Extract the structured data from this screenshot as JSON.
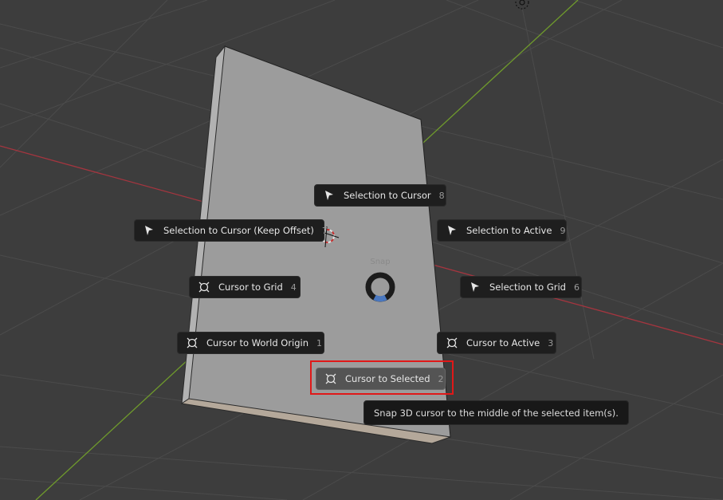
{
  "pie_menu": {
    "title": "Snap",
    "items": [
      {
        "label": "Selection to Cursor",
        "shortcut": "8",
        "icon": "cursor-arrow-icon"
      },
      {
        "label": "Selection to Cursor (Keep Offset)",
        "shortcut": "7",
        "icon": "cursor-arrow-icon"
      },
      {
        "label": "Selection to Active",
        "shortcut": "9",
        "icon": "cursor-arrow-icon"
      },
      {
        "label": "Cursor to Grid",
        "shortcut": "4",
        "icon": "3d-cursor-icon"
      },
      {
        "label": "Selection to Grid",
        "shortcut": "6",
        "icon": "cursor-arrow-icon"
      },
      {
        "label": "Cursor to World Origin",
        "shortcut": "1",
        "icon": "3d-cursor-icon"
      },
      {
        "label": "Cursor to Active",
        "shortcut": "3",
        "icon": "3d-cursor-icon"
      },
      {
        "label": "Cursor to Selected",
        "shortcut": "2",
        "icon": "3d-cursor-icon"
      }
    ],
    "active_item": "Cursor to Selected"
  },
  "tooltip": {
    "text": "Snap 3D cursor to the middle of the selected item(s)."
  },
  "colors": {
    "background": "#3d3d3d",
    "grid": "#4a4a4a",
    "x_axis": "#a5353f",
    "y_axis": "#6f9a2c",
    "object_face": "#9b9b9b",
    "menu_bg": "#1e1e1e",
    "menu_active": "#545454",
    "highlight": "#e01818"
  }
}
